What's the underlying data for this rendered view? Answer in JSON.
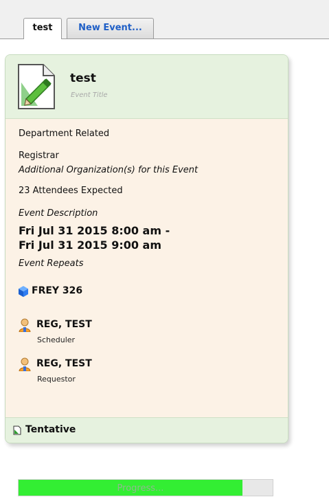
{
  "tabs": [
    {
      "label": "test",
      "active": true
    },
    {
      "label": "New Event...",
      "active": false
    }
  ],
  "event": {
    "title": "test",
    "title_caption": "Event Title",
    "type": "Department Related",
    "organization": "Registrar",
    "organization_caption": "Additional Organization(s) for this Event",
    "attendees": "23 Attendees Expected",
    "description_caption": "Event Description",
    "time_line1": "Fri Jul 31 2015 8:00 am -",
    "time_line2": "Fri Jul 31 2015 9:00 am",
    "repeats_caption": "Event Repeats",
    "room": "FREY 326",
    "contacts": [
      {
        "name": "REG, TEST",
        "role": "Scheduler"
      },
      {
        "name": "REG, TEST",
        "role": "Requestor"
      }
    ],
    "status": "Tentative"
  },
  "progress": {
    "label": "Progress...",
    "percent": 88
  },
  "icons": {
    "document": "document-edit-icon",
    "room": "blue-cube-icon",
    "contact": "user-icon",
    "status": "document-status-icon"
  },
  "colors": {
    "header_bg": "#e6f2df",
    "body_bg": "#fcf2e6",
    "link_blue": "#1f5fc7",
    "progress_green": "#33ee33"
  }
}
